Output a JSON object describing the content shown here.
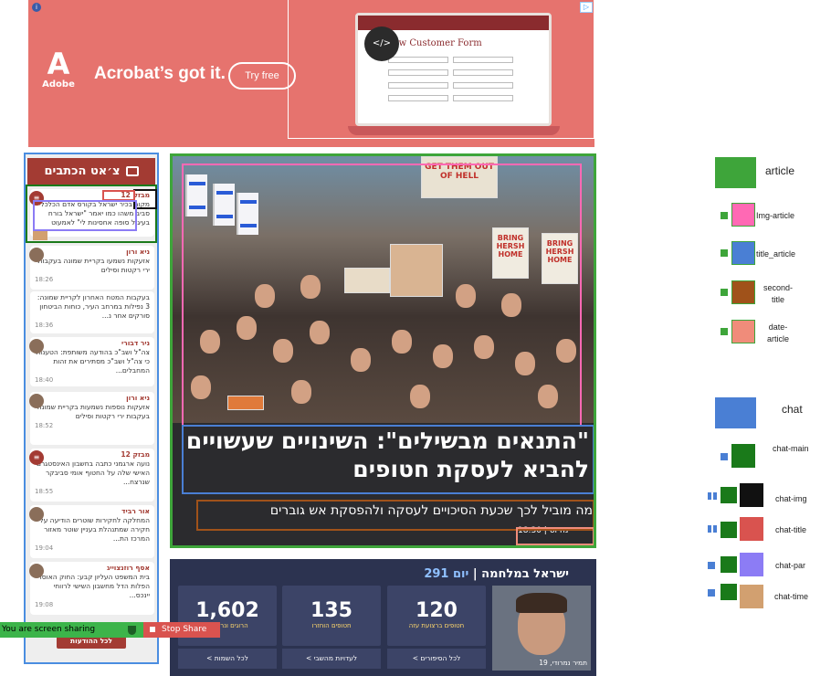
{
  "ad": {
    "brand": "Adobe",
    "brand_letter": "A",
    "headline": "Acrobat’s got it.",
    "cta": "Try free",
    "form_title": "New Customer Form",
    "info_icon": "info-icon",
    "close_icon": "ad-choices-icon"
  },
  "chat": {
    "header": "צ׳אט הכתבים",
    "messages": [
      {
        "name": "מבזק 12",
        "text": "מקור בכיר ישראל בקורס אדם הכלכלי סביב משהו כמו יאמר \"ישראל בורח בעיגול סופה אחסינות לי\" לאמעוט עבודה הפסקת א...",
        "time": "18:36"
      },
      {
        "name": "ניא ורון",
        "text": "אזעקות נשמעו בקריית שמונה בעקבות ירי רקטות וסילים",
        "time": "18:26"
      },
      {
        "name": "",
        "text": "בעקבות המטח האחרון לקריית שמונה: 3 נפילות במרחב העיר, כוחות הביטחון סורקים אחר נ...",
        "time": "18:36"
      },
      {
        "name": "ניר דבורי",
        "text": "צה\"ל ושב\"כ בהודעה משותפת: הטענות כי צה\"ל ושב\"כ מסתירים את זהות המחבלים...",
        "time": "18:40"
      },
      {
        "name": "ניא ורון",
        "text": "אזעקות נוספות נשמעות בקריית שמונה בעקבות ירי רקטות וסילים",
        "time": "18:52"
      },
      {
        "name": "מבזק 12",
        "text": "נועה ארגמני כתבה בחשבון האינסטגרם האישי שלה על החטוף אומי סביבקר שנרצח...",
        "time": "18:55"
      },
      {
        "name": "אור רביד",
        "text": "המחלקה לחקירות שוטרים הודיעה על חקירה שמתנהלת בעניין שוטר מאזור המרכז הת...",
        "time": "19:04"
      },
      {
        "name": "אסף רוזנצוייג",
        "text": "בית המשפט העליון קבע: החוק האוסר הפלות הדל מחשבון השישי לרווחי יינכס...",
        "time": "19:08"
      }
    ],
    "more_button": "לכל ההודעות"
  },
  "article": {
    "title": "\"התנאים מבשילים\": השינויים שעשויים להביא לעסקת חטופים",
    "subtitle": "מה מוביל לכך שכעת הסיכויים לעסקה ולהפסקת אש גוברים",
    "date": "נה וס | 18:30",
    "photo_signs": [
      "BRING HERSH HOME",
      "BRING HERSH HOME",
      "GET THEM OUT OF HELL",
      "NOW"
    ]
  },
  "stats": {
    "title": "ישראל במלחמה",
    "day_label": "יום 291",
    "cards": [
      {
        "num": "1,602",
        "label": "הרוגים ונרצחים",
        "link": "לכל השמות >"
      },
      {
        "num": "135",
        "label": "חטופים הוחזרו",
        "link": "לעדויות מהשבי >"
      },
      {
        "num": "120",
        "label": "חטופים ברצועת עזה",
        "link": "לכל הסיפורים >"
      }
    ],
    "person_caption": "תמיר נמרודי, 19"
  },
  "legend": {
    "article": "article",
    "img_article": "Img-article",
    "title_article": "title_article",
    "second_title": "second-title",
    "date_article": "date-article",
    "chat": "chat",
    "chat_main": "chat-main",
    "chat_img": "chat-img",
    "chat_title": "chat-title",
    "chat_par": "chat-par",
    "chat_time": "chat-time"
  },
  "colors": {
    "article": "#3ea53a",
    "img_article": "#ff69b4",
    "title_article": "#4a7fd4",
    "second_title": "#a0521a",
    "date_article": "#f08c7a",
    "chat": "#4a7fd4",
    "chat_main": "#1a7a1a",
    "chat_img": "#111111",
    "chat_title": "#d9534f",
    "chat_par": "#8c7cf5",
    "chat_time": "#d2a070"
  },
  "screen_share": {
    "status": "You are screen sharing",
    "stop": "Stop Share"
  }
}
